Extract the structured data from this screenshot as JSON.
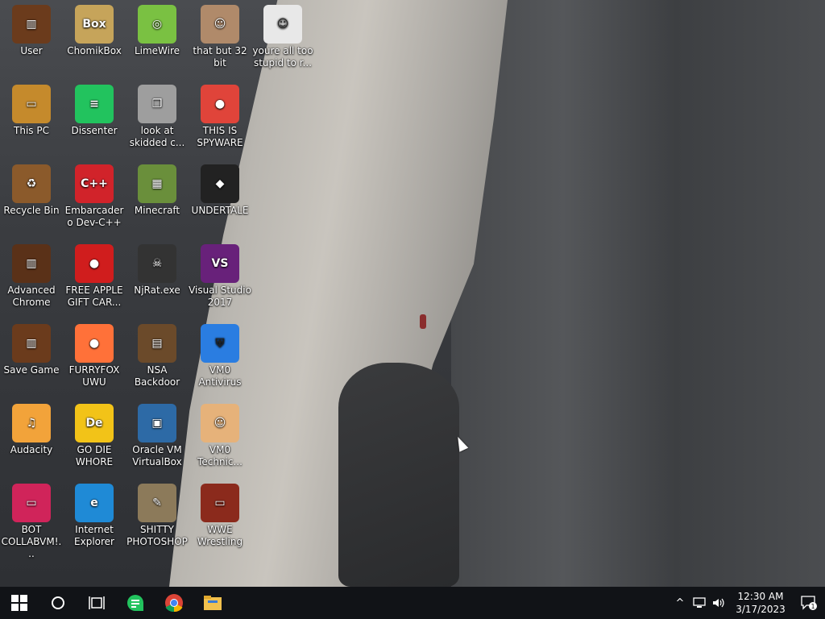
{
  "desktop": {
    "icons": [
      {
        "label": "User",
        "icon": "folder-user-icon",
        "color": "#6b3b1c"
      },
      {
        "label": "ChomikBox",
        "icon": "hamster-icon",
        "color": "#c6a45a"
      },
      {
        "label": "LimeWire",
        "icon": "limewire-icon",
        "color": "#7ac142"
      },
      {
        "label": "that but 32 bit",
        "icon": "portrait-icon",
        "color": "#b08a6a"
      },
      {
        "label": "youre all too stupid to r...",
        "icon": "sketch-portrait-icon",
        "color": "#e8e8e8"
      },
      {
        "label": "This PC",
        "icon": "computer-icon",
        "color": "#c58a2c"
      },
      {
        "label": "Dissenter",
        "icon": "chat-bubble-icon",
        "color": "#22c35e"
      },
      {
        "label": "look at skidded c...",
        "icon": "copy-files-icon",
        "color": "#9e9e9e"
      },
      {
        "label": "THIS IS SPYWARE",
        "icon": "chrome-icon",
        "color": "#e0443a"
      },
      {
        "label": "Recycle Bin",
        "icon": "recycle-bin-icon",
        "color": "#8b5a2b"
      },
      {
        "label": "Embarcadero Dev-C++",
        "icon": "devcpp-icon",
        "color": "#d1232a"
      },
      {
        "label": "Minecraft",
        "icon": "grass-block-icon",
        "color": "#6a8f3b"
      },
      {
        "label": "UNDERTALE",
        "icon": "unity-icon",
        "color": "#222222"
      },
      {
        "label": "Advanced Chrome",
        "icon": "book-icon",
        "color": "#5a3118"
      },
      {
        "label": "FREE APPLE GIFT CAR...",
        "icon": "apple-icon",
        "color": "#d01d1d"
      },
      {
        "label": "NjRat.exe",
        "icon": "skull-icon",
        "color": "#333333"
      },
      {
        "label": "Visual Studio 2017",
        "icon": "visual-studio-icon",
        "color": "#68217a"
      },
      {
        "label": "Save Game",
        "icon": "folder-icon",
        "color": "#6b3b1c"
      },
      {
        "label": "FURRYFOX UWU",
        "icon": "firefox-icon",
        "color": "#ff7139"
      },
      {
        "label": "NSA Backdoor",
        "icon": "radio-icon",
        "color": "#6b4a2a"
      },
      {
        "label": "VM0 Antivirus",
        "icon": "shield-icon",
        "color": "#2a7de1"
      },
      {
        "label": "Audacity",
        "icon": "audacity-icon",
        "color": "#f2a33a"
      },
      {
        "label": "GO DIE WHORE",
        "icon": "de-icon",
        "color": "#f2c318"
      },
      {
        "label": "Oracle VM VirtualBox",
        "icon": "virtualbox-icon",
        "color": "#2d6aa6"
      },
      {
        "label": "VM0 Technic...",
        "icon": "doctor-icon",
        "color": "#e6b27a"
      },
      {
        "label": "BOT COLLABVM!...",
        "icon": "monitor-icon",
        "color": "#d0245a"
      },
      {
        "label": "Internet Explorer",
        "icon": "edge-icon",
        "color": "#1f8ad6"
      },
      {
        "label": "SHITTY PHOTOSHOP",
        "icon": "gimp-icon",
        "color": "#8c7a5a"
      },
      {
        "label": "WWE Wrestling",
        "icon": "tv-icon",
        "color": "#8b2a1c"
      }
    ]
  },
  "taskbar": {
    "start": "windows-logo-icon",
    "search": "cortana-circle-icon",
    "task_view": "task-view-icon",
    "pinned": [
      "dissenter-icon",
      "chrome-icon",
      "file-explorer-icon"
    ],
    "tray": {
      "chevron": "^",
      "time": "12:30 AM",
      "date": "3/17/2023",
      "notifications_count": "1"
    }
  }
}
